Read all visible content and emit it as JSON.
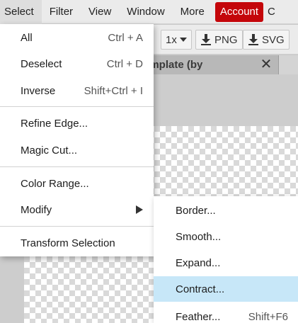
{
  "menubar": {
    "items": [
      "Select",
      "Filter",
      "View",
      "Window",
      "More"
    ],
    "account_label": "Account",
    "partial_label": "C"
  },
  "toolbar": {
    "zoom_label": "1x",
    "png_label": "PNG",
    "svg_label": "SVG"
  },
  "document_tab": {
    "title": "shop template (by",
    "close_glyph": "✕"
  },
  "select_menu": {
    "items": [
      {
        "label": "All",
        "shortcut": "Ctrl + A"
      },
      {
        "label": "Deselect",
        "shortcut": "Ctrl + D"
      },
      {
        "label": "Inverse",
        "shortcut": "Shift+Ctrl + I"
      },
      {
        "label": "Refine Edge..."
      },
      {
        "label": "Magic Cut..."
      },
      {
        "label": "Color Range..."
      },
      {
        "label": "Modify",
        "submenu": true
      },
      {
        "label": "Transform Selection"
      }
    ]
  },
  "modify_submenu": {
    "items": [
      {
        "label": "Border..."
      },
      {
        "label": "Smooth..."
      },
      {
        "label": "Expand..."
      },
      {
        "label": "Contract...",
        "highlighted": true
      },
      {
        "label": "Feather...",
        "shortcut": "Shift+F6"
      }
    ]
  },
  "colors": {
    "account_bg": "#c4060a",
    "highlight_bg": "#c7e7f8",
    "menubar_bg": "#ebebeb"
  }
}
